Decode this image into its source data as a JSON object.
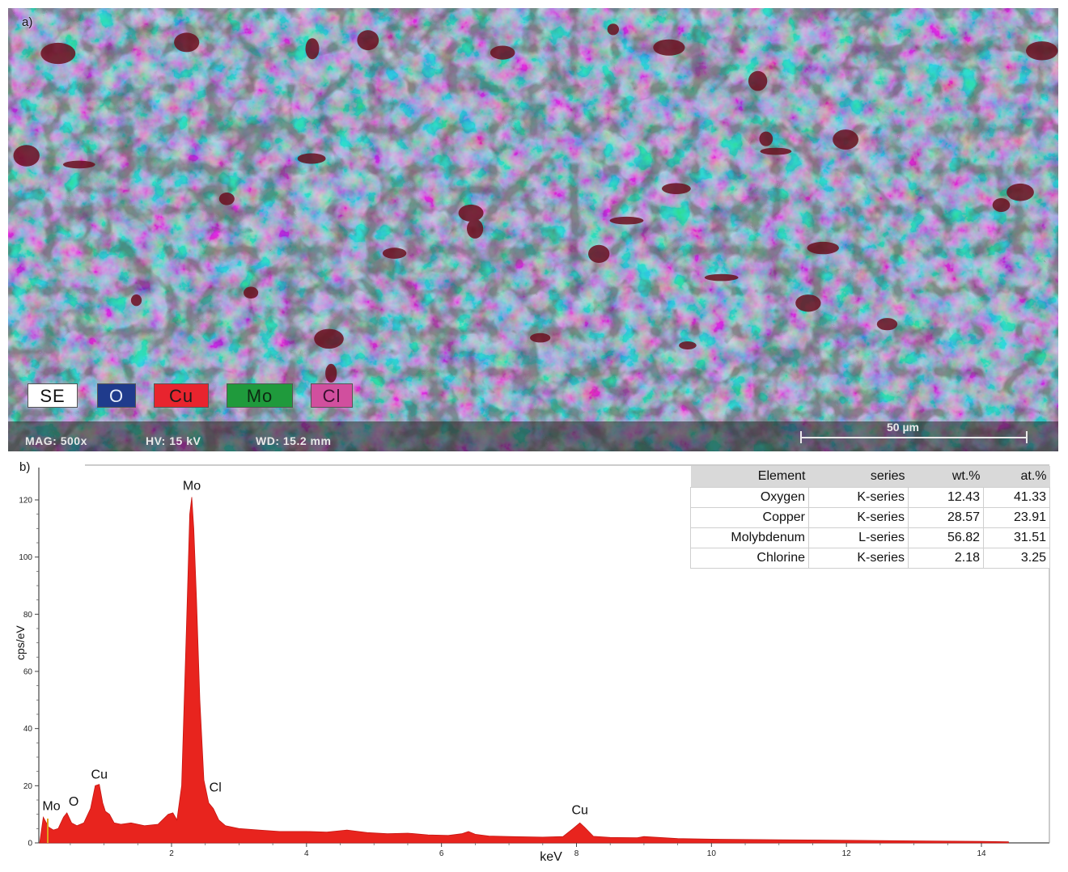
{
  "panel_a": {
    "label": "a)",
    "legend": [
      {
        "text": "SE",
        "bg": "#ffffff",
        "fg": "#111111"
      },
      {
        "text": "O",
        "bg": "#1f3b8c",
        "fg": "#e8eefc"
      },
      {
        "text": "Cu",
        "bg": "#e8242e",
        "fg": "#1a1a1a"
      },
      {
        "text": "Mo",
        "bg": "#1f9a3c",
        "fg": "#0d2a12"
      },
      {
        "text": "Cl",
        "bg": "#d14f9e",
        "fg": "#3a1030"
      }
    ],
    "info": {
      "mag": "MAG: 500x",
      "hv": "HV: 15 kV",
      "wd": "WD: 15.2 mm",
      "scale": "50 µm"
    }
  },
  "panel_b": {
    "label": "b)",
    "table": {
      "headers": [
        "Element",
        "series",
        "wt.%",
        "at.%"
      ],
      "rows": [
        [
          "Oxygen",
          "K-series",
          "12.43",
          "41.33"
        ],
        [
          "Copper",
          "K-series",
          "28.57",
          "23.91"
        ],
        [
          "Molybdenum",
          "L-series",
          "56.82",
          "31.51"
        ],
        [
          "Chlorine",
          "K-series",
          "2.18",
          "3.25"
        ]
      ]
    }
  },
  "chart_data": {
    "type": "area",
    "xlabel": "keV",
    "ylabel": "cps/eV",
    "xlim": [
      0,
      14.4
    ],
    "ylim": [
      0,
      125
    ],
    "x_ticks": [
      2,
      4,
      6,
      8,
      10,
      12,
      14
    ],
    "y_ticks": [
      0,
      20,
      40,
      60,
      80,
      100,
      120
    ],
    "color": "#e8241e",
    "series": [
      {
        "x": [
          0.0,
          0.1,
          0.18,
          0.25,
          0.32,
          0.4,
          0.45,
          0.52,
          0.6,
          0.7,
          0.8,
          0.87,
          0.93,
          0.98,
          1.02,
          1.08,
          1.15,
          1.25,
          1.4,
          1.6,
          1.8,
          1.95,
          2.02,
          2.08,
          2.15,
          2.22,
          2.27,
          2.3,
          2.33,
          2.37,
          2.42,
          2.48,
          2.55,
          2.62,
          2.7,
          2.8,
          3.0,
          3.3,
          3.6,
          4.0,
          4.3,
          4.6,
          4.9,
          5.2,
          5.5,
          5.8,
          6.1,
          6.3,
          6.4,
          6.5,
          6.7,
          7.0,
          7.5,
          7.8,
          7.95,
          8.05,
          8.12,
          8.25,
          8.5,
          8.9,
          9.0,
          9.5,
          10.0,
          11.0,
          12.0,
          13.0,
          14.0,
          14.4
        ],
        "y": [
          0,
          9.0,
          5.5,
          4.5,
          5.0,
          9.0,
          10.5,
          7.0,
          6.0,
          7.0,
          12.0,
          20.0,
          20.5,
          14.0,
          11.0,
          10.0,
          7.0,
          6.5,
          7.0,
          6.0,
          6.5,
          10.0,
          10.5,
          8.0,
          20.0,
          75.0,
          115.0,
          121.0,
          110.0,
          85.0,
          50.0,
          22.0,
          14.0,
          12.0,
          8.0,
          6.0,
          5.0,
          4.5,
          4.0,
          4.0,
          3.8,
          4.5,
          3.6,
          3.2,
          3.4,
          2.8,
          2.6,
          3.2,
          4.0,
          3.0,
          2.4,
          2.2,
          2.0,
          2.2,
          5.0,
          7.0,
          5.5,
          2.3,
          1.9,
          1.8,
          2.2,
          1.5,
          1.3,
          1.1,
          0.9,
          0.7,
          0.5,
          0.4
        ]
      }
    ],
    "peak_labels": [
      {
        "text": "Mo",
        "x": 0.22,
        "y": 11.5
      },
      {
        "text": "O",
        "x": 0.55,
        "y": 13.0
      },
      {
        "text": "Cu",
        "x": 0.93,
        "y": 22.5
      },
      {
        "text": "Mo",
        "x": 2.3,
        "y": 123.5
      },
      {
        "text": "Cl",
        "x": 2.65,
        "y": 18.0
      },
      {
        "text": "Cu",
        "x": 8.05,
        "y": 10.0
      }
    ]
  }
}
